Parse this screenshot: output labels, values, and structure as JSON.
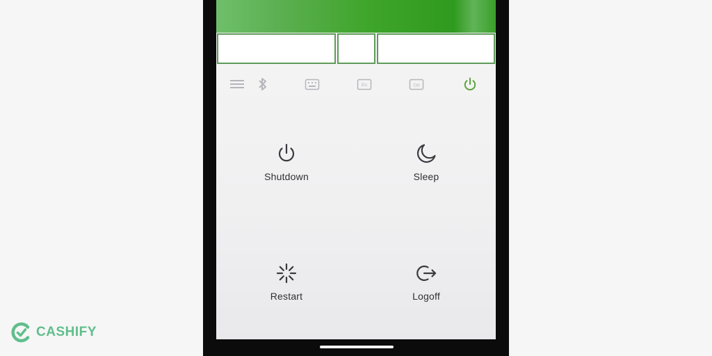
{
  "toolbar": {
    "icons": [
      "menu-icon",
      "bluetooth-icon",
      "keyboard-icon",
      "fn-key-icon",
      "ctrl-key-icon",
      "power-icon"
    ],
    "active_icon": "power-icon",
    "fn_label": "Fn",
    "ctrl_label": "Ctrl",
    "active_color": "#5aa63c",
    "inactive_color": "#b5b5bb"
  },
  "actions": [
    {
      "label": "Shutdown",
      "icon": "power-icon"
    },
    {
      "label": "Sleep",
      "icon": "moon-icon"
    },
    {
      "label": "Restart",
      "icon": "restart-spinner-icon"
    },
    {
      "label": "Logoff",
      "icon": "logoff-icon"
    }
  ],
  "brand": {
    "logo_text": "CASHIFY",
    "color": "#5fbe8c"
  }
}
